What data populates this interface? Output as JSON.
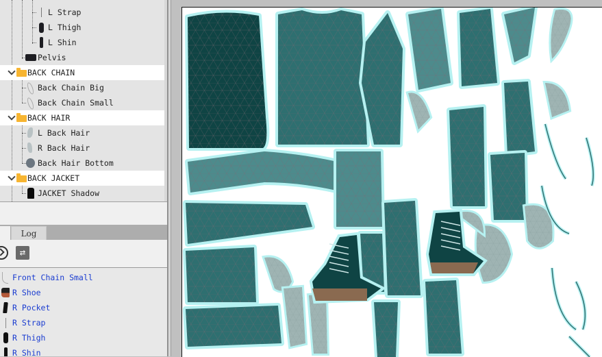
{
  "hierarchy": {
    "rows": [
      {
        "type": "item",
        "label": "L Strap",
        "icon": "strap-thumbnail"
      },
      {
        "type": "item",
        "label": "L Thigh",
        "icon": "thigh-thumbnail"
      },
      {
        "type": "item",
        "label": "L Shin",
        "icon": "shin-thumbnail"
      },
      {
        "type": "item",
        "label": "Pelvis",
        "icon": "pelvis-thumbnail"
      },
      {
        "type": "folder",
        "label": "BACK CHAIN",
        "expanded": true
      },
      {
        "type": "item",
        "label": "Back Chain Big",
        "icon": "chain-thumbnail"
      },
      {
        "type": "item",
        "label": "Back Chain Small",
        "icon": "chain-thumbnail"
      },
      {
        "type": "folder",
        "label": "BACK HAIR",
        "expanded": true
      },
      {
        "type": "item",
        "label": "L Back Hair",
        "icon": "hair-thumbnail"
      },
      {
        "type": "item",
        "label": "R Back Hair",
        "icon": "hair-thumbnail"
      },
      {
        "type": "item",
        "label": "Back Hair Bottom",
        "icon": "hair-bottom-thumbnail"
      },
      {
        "type": "folder",
        "label": "BACK JACKET",
        "expanded": true
      },
      {
        "type": "item",
        "label": "JACKET Shadow",
        "icon": "jacket-shadow-thumbnail"
      }
    ]
  },
  "tabs": {
    "log_label": "Log"
  },
  "toolbar": {
    "play_icon": "play-circle-icon",
    "swap_icon": "swap-arrows-icon",
    "swap_glyph": "⇄"
  },
  "parts_list": {
    "items": [
      {
        "label": "Front Chain Small",
        "icon": "chain-thumbnail"
      },
      {
        "label": "R Shoe",
        "icon": "shoe-thumbnail"
      },
      {
        "label": "R Pocket",
        "icon": "pocket-thumbnail"
      },
      {
        "label": "R Strap",
        "icon": "strap-thumbnail"
      },
      {
        "label": "R Thigh",
        "icon": "thigh-thumbnail"
      },
      {
        "label": "R Shin",
        "icon": "shin-thumbnail"
      }
    ],
    "text_color": "#1a3cd0"
  },
  "texture_atlas": {
    "description": "UV texture atlas of jacket, shoes and hair mesh parts",
    "palette": {
      "dark_teal": "#0f4444",
      "mid_teal": "#2e6f70",
      "light_teal": "#4d8b8c",
      "outline_cyan": "#b6f1f1",
      "hair_gray": "#9fb4b3",
      "shoe_brown": "#8a6a50"
    }
  }
}
